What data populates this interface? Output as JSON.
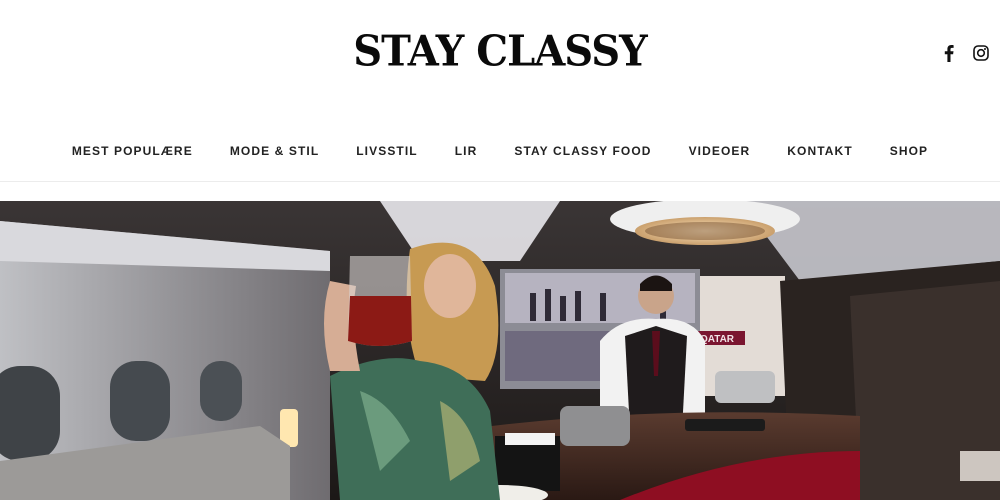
{
  "site": {
    "logo": "STAY CLASSY"
  },
  "social": [
    {
      "icon": "facebook-icon"
    },
    {
      "icon": "instagram-icon"
    }
  ],
  "nav": {
    "items": [
      {
        "label": "MEST POPULÆRE"
      },
      {
        "label": "MODE & STIL"
      },
      {
        "label": "LIVSSTIL"
      },
      {
        "label": "LIR"
      },
      {
        "label": "STAY CLASSY FOOD"
      },
      {
        "label": "VIDEOER"
      },
      {
        "label": "KONTAKT"
      },
      {
        "label": "SHOP"
      }
    ]
  },
  "hero": {
    "sign_text": "QATAR",
    "colors": {
      "cabin": "#2a2523",
      "bar_light": "#d8cfc9",
      "accent_red": "#a0122a"
    }
  }
}
